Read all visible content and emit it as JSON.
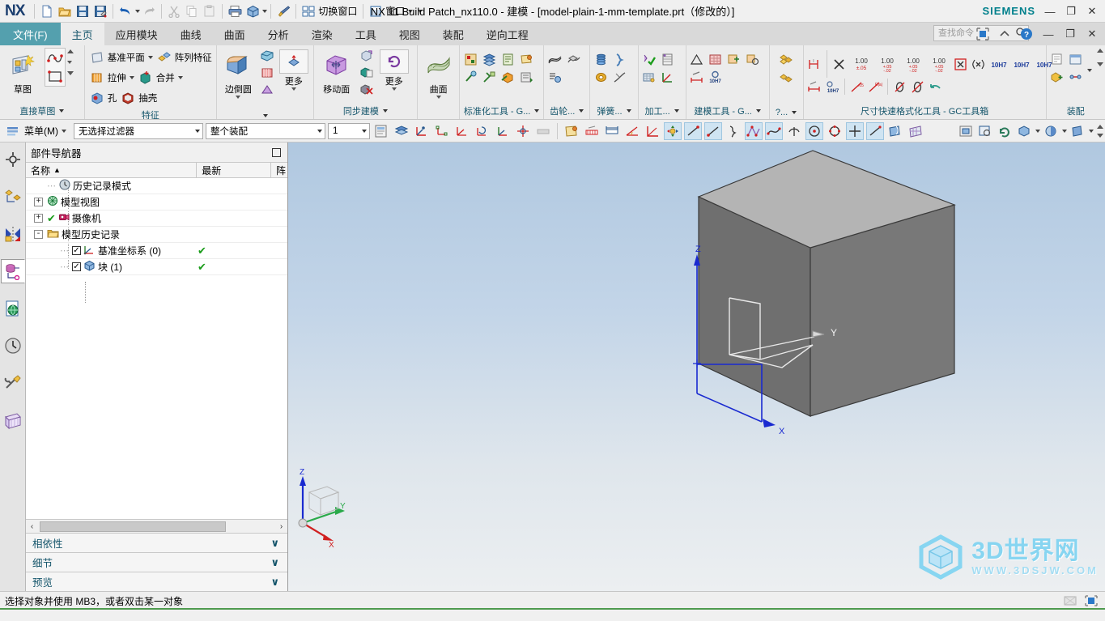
{
  "window": {
    "title": "NX 11  Build Patch_nx110.0 - 建模 - [model-plain-1-mm-template.prt（修改的）]",
    "brand": "SIEMENS",
    "logo": "NX",
    "minimize": "—",
    "restore": "❐",
    "close": "✕"
  },
  "quickaccess": {
    "items": [
      {
        "name": "new-file-icon",
        "label": ""
      },
      {
        "name": "open-file-icon",
        "label": ""
      },
      {
        "name": "save-icon",
        "label": ""
      },
      {
        "name": "save-as-icon",
        "label": ""
      },
      {
        "name": "undo-icon",
        "label": ""
      },
      {
        "name": "redo-icon",
        "label": ""
      },
      {
        "name": "cut-icon",
        "label": ""
      },
      {
        "name": "copy-icon",
        "label": ""
      },
      {
        "name": "paste-icon",
        "label": ""
      },
      {
        "name": "print-icon",
        "label": ""
      },
      {
        "name": "render-cube-icon",
        "label": ""
      },
      {
        "name": "paintbrush-icon",
        "label": ""
      }
    ],
    "switch_window": "切换窗口",
    "window_menu": "窗口"
  },
  "tabs": {
    "file": "文件(F)",
    "items": [
      "主页",
      "应用模块",
      "曲线",
      "曲面",
      "分析",
      "渲染",
      "工具",
      "视图",
      "装配",
      "逆向工程"
    ],
    "active": "主页"
  },
  "search": {
    "placeholder": "查找命令"
  },
  "ribbon": {
    "groups": [
      {
        "name": "direct-sketch",
        "label": "直接草图",
        "big": [
          {
            "label": "草图",
            "icon": "sketch-icon"
          }
        ],
        "small": []
      },
      {
        "name": "feature",
        "label": "特征",
        "big": [],
        "small": [
          {
            "label": "基准平面",
            "icon": "datum-plane-icon",
            "dropdown": true
          },
          {
            "label": "拉伸",
            "icon": "extrude-icon",
            "dropdown": true
          },
          {
            "label": "孔",
            "icon": "hole-icon",
            "dropdown": false
          },
          {
            "label": "阵列特征",
            "icon": "pattern-feature-icon",
            "dropdown": false
          },
          {
            "label": "合并",
            "icon": "unite-icon",
            "dropdown": true
          },
          {
            "label": "抽壳",
            "icon": "shell-icon",
            "dropdown": false
          }
        ]
      },
      {
        "name": "edge-blend",
        "label": "",
        "big": [
          {
            "label": "边倒圆",
            "icon": "edge-blend-icon"
          },
          {
            "label": "更多",
            "icon": "more-icon"
          }
        ],
        "small": []
      },
      {
        "name": "synchronous-modeling",
        "label": "同步建模",
        "big": [
          {
            "label": "移动面",
            "icon": "move-face-icon"
          },
          {
            "label": "更多",
            "icon": "more-sync-icon"
          }
        ],
        "small": []
      },
      {
        "name": "surface",
        "label": "",
        "big": [
          {
            "label": "曲面",
            "icon": "surface-icon"
          }
        ],
        "small": []
      },
      {
        "name": "standardization-tools",
        "label": "标准化工具 - G...",
        "big": [],
        "small": []
      },
      {
        "name": "gear-toolbox",
        "label": "齿轮...",
        "big": [],
        "small": []
      },
      {
        "name": "spring-toolbox",
        "label": "弹簧...",
        "big": [],
        "small": []
      },
      {
        "name": "machining-toolbox",
        "label": "加工...",
        "big": [],
        "small": []
      },
      {
        "name": "modeling-tools",
        "label": "建模工具 - G...",
        "big": [],
        "small": []
      },
      {
        "name": "assembly-misc",
        "label": "?...",
        "big": [],
        "small": []
      },
      {
        "name": "dimension-format-tools",
        "label": "尺寸快速格式化工具 - GC工具箱",
        "big": [],
        "small": []
      },
      {
        "name": "assembly-group",
        "label": "装配",
        "big": [],
        "small": []
      }
    ],
    "tolerance_labels": [
      "1.00",
      "1.00",
      "1.00",
      "1.00"
    ],
    "fit_labels": [
      "10H7",
      "10H7",
      "10H7",
      "10H7"
    ]
  },
  "selection_toolbar": {
    "menu": "菜单(M)",
    "filter": "无选择过滤器",
    "scope": "整个装配",
    "layer": "1"
  },
  "navigator": {
    "title": "部件导航器",
    "columns": [
      "名称",
      "最新",
      "阵"
    ],
    "sort_arrow": "▲",
    "rows": [
      {
        "label": "历史记录模式",
        "icon": "clock-icon",
        "indent": 0,
        "expander": "",
        "checkbox": false,
        "status": ""
      },
      {
        "label": "模型视图",
        "icon": "model-views-icon",
        "indent": 0,
        "expander": "+",
        "checkbox": false,
        "status": ""
      },
      {
        "label": "摄像机",
        "icon": "camera-icon",
        "indent": 0,
        "expander": "+",
        "checkbox": false,
        "status": "",
        "leadcheck": true
      },
      {
        "label": "模型历史记录",
        "icon": "folder-icon",
        "indent": 0,
        "expander": "-",
        "checkbox": false,
        "status": ""
      },
      {
        "label": "基准坐标系 (0)",
        "icon": "datum-csys-icon",
        "indent": 1,
        "expander": "",
        "checkbox": true,
        "status": "✔"
      },
      {
        "label": "块 (1)",
        "icon": "block-icon",
        "indent": 1,
        "expander": "",
        "checkbox": true,
        "status": "✔"
      }
    ],
    "panels": [
      "相依性",
      "细节",
      "预览"
    ],
    "chevron": "∨",
    "scroll_left": "‹",
    "scroll_right": "›"
  },
  "resource_bar": [
    {
      "name": "assembly-constraints-icon"
    },
    {
      "name": "assembly-navigator-icon"
    },
    {
      "name": "constraint-navigator-icon"
    },
    {
      "name": "part-navigator-icon",
      "selected": true
    },
    {
      "name": "web-browser-icon"
    },
    {
      "name": "history-icon"
    },
    {
      "name": "tools-icon"
    },
    {
      "name": "reuse-library-icon"
    }
  ],
  "viewport": {
    "axes": {
      "x": "X",
      "y": "Y",
      "z": "Z"
    },
    "triad": {
      "x": "X",
      "y": "Y",
      "z": "Z"
    },
    "watermark_main": "3D世界网",
    "watermark_sub": "WWW.3DSJW.COM",
    "model": "块 (1)"
  },
  "status_bar": {
    "message": "选择对象并使用 MB3，或者双击某一对象"
  }
}
